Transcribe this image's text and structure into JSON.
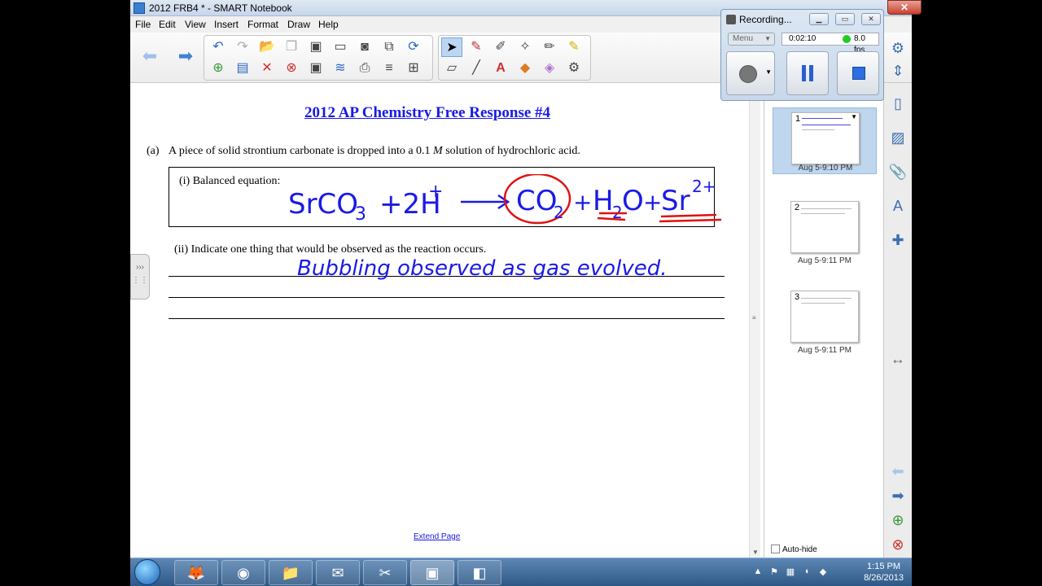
{
  "window": {
    "title": "2012 FRB4 * - SMART Notebook",
    "close_label": "✕"
  },
  "menu": [
    "File",
    "Edit",
    "View",
    "Insert",
    "Format",
    "Draw",
    "Help"
  ],
  "document": {
    "title": "2012 AP Chemistry Free Response #4",
    "part_a_label": "(a)",
    "part_a_text_before": "A piece of solid strontium carbonate is dropped into a 0.1",
    "part_a_italic": "M",
    "part_a_text_after": "solution of hydrochloric acid.",
    "balanced_label": "(i) Balanced equation:",
    "part_ii": "(ii) Indicate one thing that would be observed as the reaction occurs.",
    "handwritten_equation": "SrCO3 + 2H+ → CO2 + H2O + Sr2+",
    "handwritten_answer": "Bubbling observed as gas evolved.",
    "extend_page": "Extend Page"
  },
  "sorter": {
    "pages": [
      {
        "number": "1",
        "date": "Aug 5-9:10 PM",
        "selected": true
      },
      {
        "number": "2",
        "date": "Aug 5-9:11 PM",
        "selected": false
      },
      {
        "number": "3",
        "date": "Aug 5-9:11 PM",
        "selected": false
      }
    ],
    "autohide": "Auto-hide"
  },
  "recorder": {
    "title": "Recording...",
    "menu": "Menu",
    "time": "0:02:10",
    "fps": "8.0 fps"
  },
  "taskbar": {
    "time": "1:15 PM",
    "date": "8/26/2013"
  },
  "colors": {
    "ink_blue": "#1a1ae6",
    "ink_red": "#e01010",
    "accent": "#3d83d6"
  }
}
